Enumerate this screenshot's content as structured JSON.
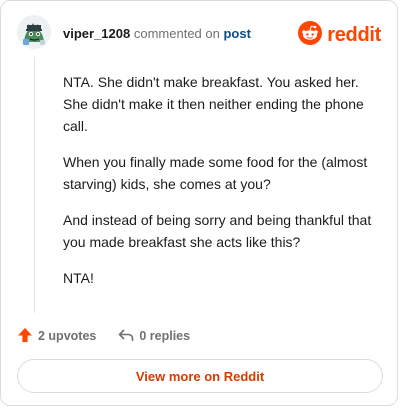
{
  "comment": {
    "username": "viper_1208",
    "action_text": "commented on",
    "post_link": "post",
    "paragraphs": [
      "NTA. She didn't make breakfast. You asked her. She didn't make it then neither ending the phone call.",
      "When you finally made some food for the (almost starving) kids, she comes at you?",
      "And instead of being sorry and being thankful that you made breakfast she acts like this?",
      "NTA!"
    ]
  },
  "brand": {
    "name": "reddit",
    "icon": "reddit-logo-icon",
    "color": "#ff4500"
  },
  "actions": {
    "upvotes": "2 upvotes",
    "upvote_icon": "upvote-arrow-icon",
    "replies": "0 replies",
    "reply_icon": "reply-arrow-icon"
  },
  "footer": {
    "view_more": "View more on Reddit"
  },
  "colors": {
    "accent": "#ff4500",
    "link": "#0b4d8a",
    "button_text": "#d93a00",
    "muted": "#6f7173"
  }
}
